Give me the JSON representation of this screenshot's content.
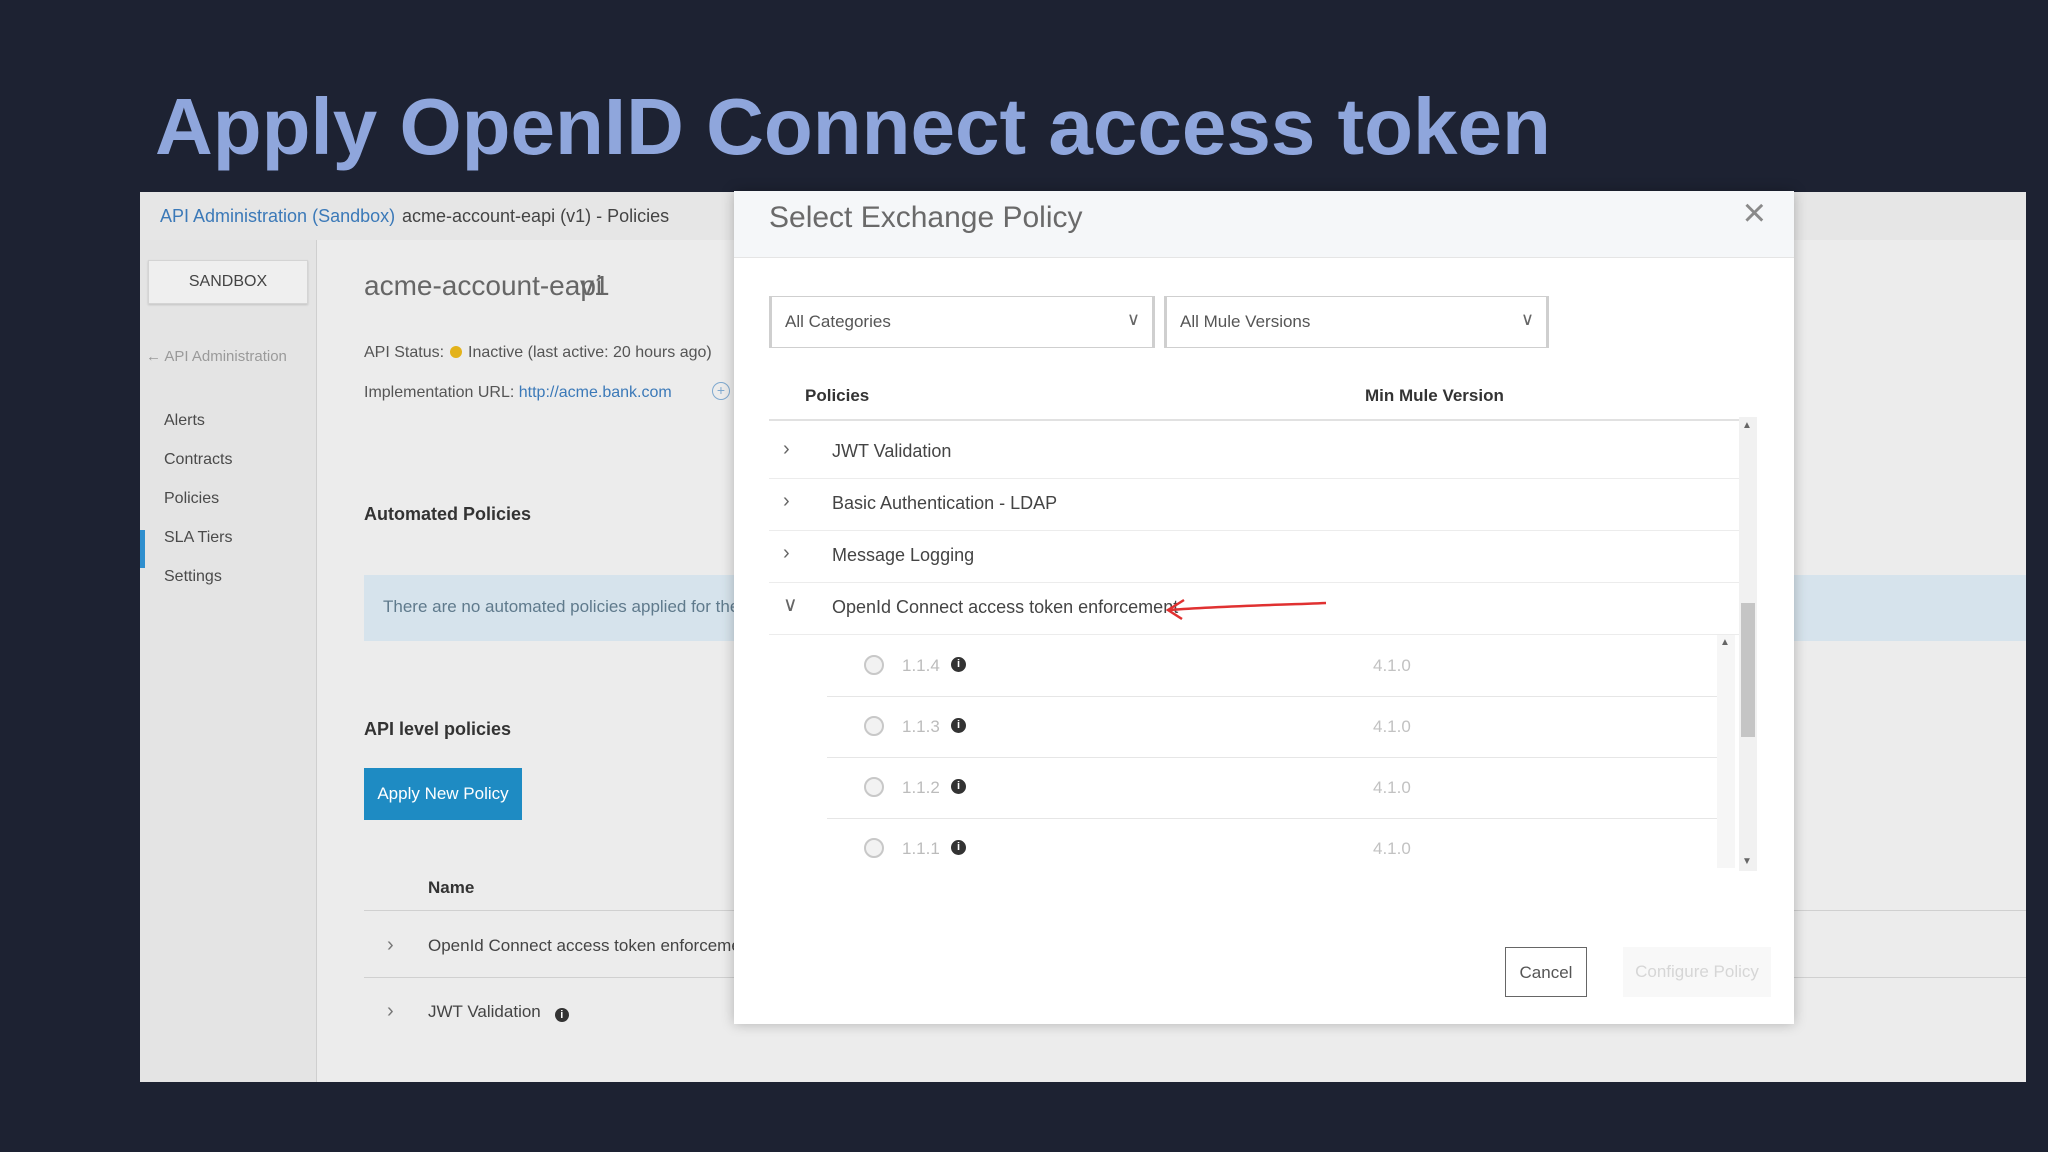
{
  "slide": {
    "title": "Apply OpenID Connect access token"
  },
  "topbar": {
    "breadcrumb_link": "API Administration (Sandbox)",
    "breadcrumb_page": "acme-account-eapi (v1) - Policies"
  },
  "sidebar": {
    "environment_button": "SANDBOX",
    "back_link": "← API Administration",
    "items": [
      {
        "label": "Alerts"
      },
      {
        "label": "Contracts"
      },
      {
        "label": "Policies",
        "active": true
      },
      {
        "label": "SLA Tiers"
      },
      {
        "label": "Settings"
      }
    ]
  },
  "main": {
    "api_name": "acme-account-eapi",
    "api_version": "v1",
    "status_label": "API Status:",
    "status_value": "Inactive (last active: 20 hours ago)",
    "impl_label": "Implementation URL:",
    "impl_url": "http://acme.bank.com",
    "automated_heading": "Automated Policies",
    "automated_empty": "There are no automated policies applied for the",
    "api_level_heading": "API level policies",
    "apply_button": "Apply New Policy",
    "table_header_name": "Name",
    "rows": [
      {
        "label": "OpenId Connect access token enforceme"
      },
      {
        "label": "JWT Validation"
      }
    ]
  },
  "modal": {
    "title": "Select Exchange Policy",
    "category_select": "All Categories",
    "version_select": "All Mule Versions",
    "col_policies": "Policies",
    "col_min_version": "Min Mule Version",
    "policies": [
      {
        "label": "JWT Validation",
        "expanded": false
      },
      {
        "label": "Basic Authentication - LDAP",
        "expanded": false
      },
      {
        "label": "Message Logging",
        "expanded": false
      },
      {
        "label": "OpenId Connect access token enforcement",
        "expanded": true
      }
    ],
    "versions": [
      {
        "version": "1.1.4",
        "min_mule": "4.1.0"
      },
      {
        "version": "1.1.3",
        "min_mule": "4.1.0"
      },
      {
        "version": "1.1.2",
        "min_mule": "4.1.0"
      },
      {
        "version": "1.1.1",
        "min_mule": "4.1.0"
      }
    ],
    "cancel_button": "Cancel",
    "configure_button": "Configure Policy"
  },
  "colors": {
    "slide_background": "#1d2232",
    "title": "#8fa6dc",
    "primary_button": "#1e8bc3",
    "annotation_arrow": "#e03131",
    "status_inactive": "#e3b21a"
  }
}
